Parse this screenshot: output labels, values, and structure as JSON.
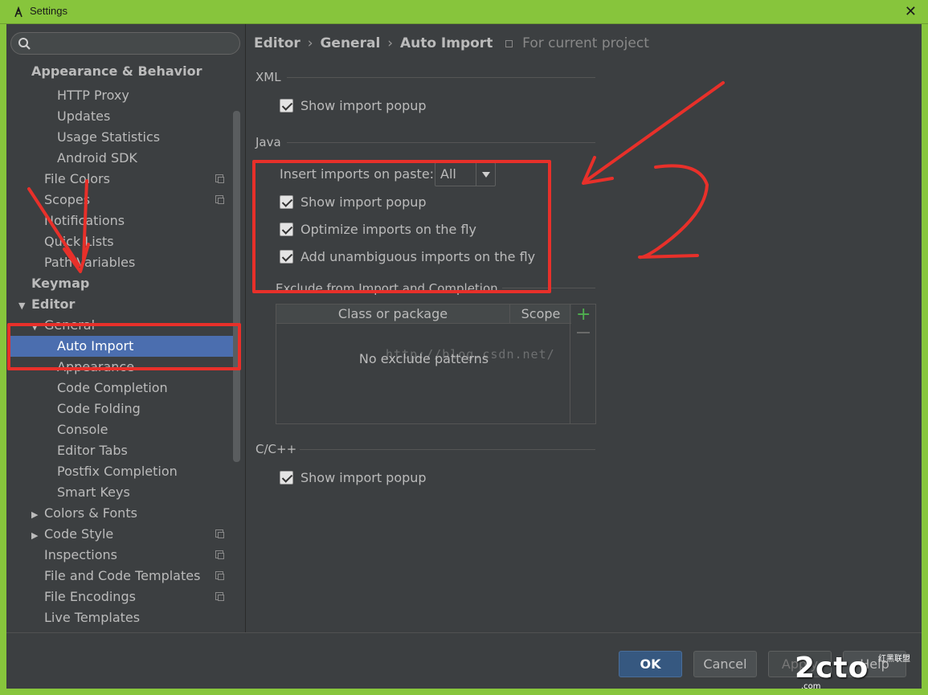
{
  "window": {
    "title": "Settings"
  },
  "sidebar": {
    "items": [
      {
        "label": "Appearance & Behavior",
        "level": 0,
        "bold": true,
        "expanded": null,
        "project": false
      },
      {
        "label": "HTTP Proxy",
        "level": 2,
        "bold": false,
        "project": false
      },
      {
        "label": "Updates",
        "level": 2,
        "bold": false,
        "project": false
      },
      {
        "label": "Usage Statistics",
        "level": 2,
        "bold": false,
        "project": false
      },
      {
        "label": "Android SDK",
        "level": 2,
        "bold": false,
        "project": false
      },
      {
        "label": "File Colors",
        "level": 1,
        "bold": false,
        "project": true
      },
      {
        "label": "Scopes",
        "level": 1,
        "bold": false,
        "project": true
      },
      {
        "label": "Notifications",
        "level": 1,
        "bold": false,
        "project": false
      },
      {
        "label": "Quick Lists",
        "level": 1,
        "bold": false,
        "project": false
      },
      {
        "label": "Path Variables",
        "level": 1,
        "bold": false,
        "project": false
      },
      {
        "label": "Keymap",
        "level": 0,
        "bold": true,
        "project": false
      },
      {
        "label": "Editor",
        "level": 0,
        "bold": true,
        "expanded": true,
        "project": false
      },
      {
        "label": "General",
        "level": 1,
        "bold": false,
        "expanded": true,
        "project": false
      },
      {
        "label": "Auto Import",
        "level": 2,
        "bold": false,
        "selected": true,
        "project": false
      },
      {
        "label": "Appearance",
        "level": 2,
        "bold": false,
        "project": false
      },
      {
        "label": "Code Completion",
        "level": 2,
        "bold": false,
        "project": false
      },
      {
        "label": "Code Folding",
        "level": 2,
        "bold": false,
        "project": false
      },
      {
        "label": "Console",
        "level": 2,
        "bold": false,
        "project": false
      },
      {
        "label": "Editor Tabs",
        "level": 2,
        "bold": false,
        "project": false
      },
      {
        "label": "Postfix Completion",
        "level": 2,
        "bold": false,
        "project": false
      },
      {
        "label": "Smart Keys",
        "level": 2,
        "bold": false,
        "project": false
      },
      {
        "label": "Colors & Fonts",
        "level": 1,
        "bold": false,
        "expanded": false,
        "project": false
      },
      {
        "label": "Code Style",
        "level": 1,
        "bold": false,
        "expanded": false,
        "project": true
      },
      {
        "label": "Inspections",
        "level": 1,
        "bold": false,
        "project": true
      },
      {
        "label": "File and Code Templates",
        "level": 1,
        "bold": false,
        "project": true
      },
      {
        "label": "File Encodings",
        "level": 1,
        "bold": false,
        "project": true
      },
      {
        "label": "Live Templates",
        "level": 1,
        "bold": false,
        "project": false
      }
    ]
  },
  "breadcrumb": {
    "part1": "Editor",
    "part2": "General",
    "part3": "Auto Import",
    "separator": "›",
    "scope_note": "For current project"
  },
  "sections": {
    "xml": {
      "title": "XML",
      "show_popup": "Show import popup"
    },
    "java": {
      "title": "Java",
      "insert_label": "Insert imports on paste:",
      "insert_value": "All",
      "show_popup": "Show import popup",
      "optimize": "Optimize imports on the fly",
      "add_unambiguous": "Add unambiguous imports on the fly",
      "exclude_title": "Exclude from Import and Completion",
      "table_col1": "Class or package",
      "table_col2": "Scope",
      "table_empty": "No exclude patterns",
      "add_symbol": "+"
    },
    "cpp": {
      "title": "C/C++",
      "show_popup": "Show import popup"
    }
  },
  "buttons": {
    "ok": "OK",
    "cancel": "Cancel",
    "apply": "Apply",
    "help": "Help"
  },
  "overlay": {
    "watermark": "http://blog.csdn.net/",
    "annotation_number": "2",
    "logo_text": "2cto",
    "logo_sub": "红黑联盟",
    "logo_url": ".com",
    "annotation_color": "#e8302a"
  },
  "colors": {
    "titlebar": "#87c53c",
    "selection": "#4b6eaf",
    "add_green": "#4fb04f"
  }
}
